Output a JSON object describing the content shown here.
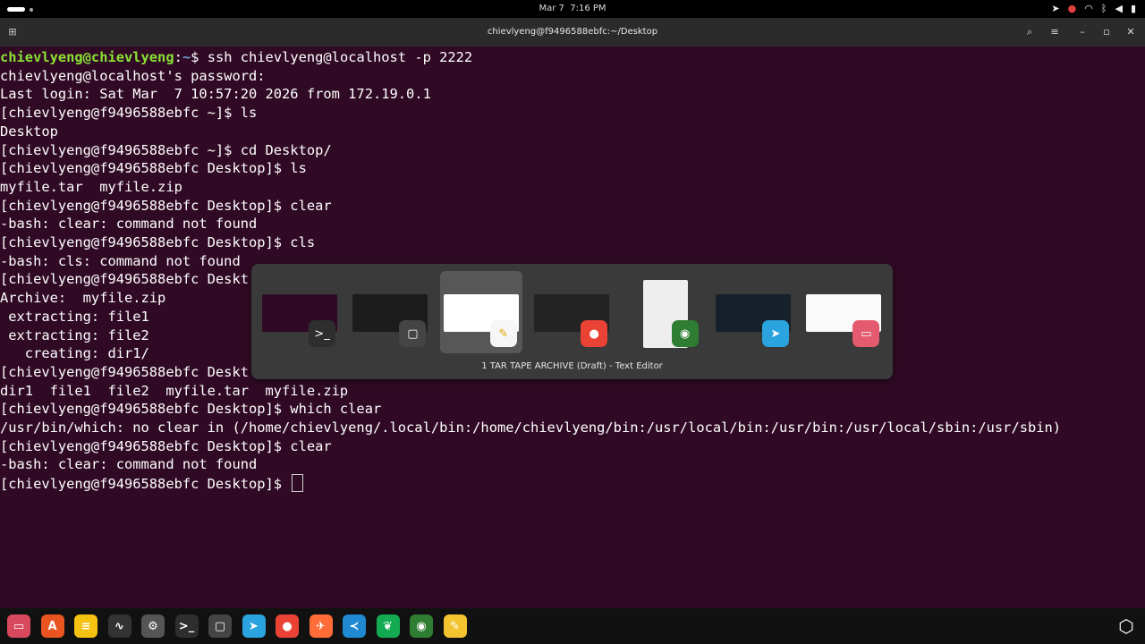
{
  "top_bar": {
    "date": "Mar 7",
    "time": "7:16 PM"
  },
  "window": {
    "title": "chievlyeng@f9496588ebfc:~/Desktop"
  },
  "terminal": {
    "lines": [
      {
        "user": "chievlyeng@chievlyeng",
        "sep": ":",
        "path": "~",
        "rest": "$ ssh chievlyeng@localhost -p 2222"
      },
      {
        "text": "chievlyeng@localhost's password:"
      },
      {
        "text": "Last login: Sat Mar  7 10:57:20 2026 from 172.19.0.1"
      },
      {
        "text": "[chievlyeng@f9496588ebfc ~]$ ls"
      },
      {
        "text": "Desktop"
      },
      {
        "text": "[chievlyeng@f9496588ebfc ~]$ cd Desktop/"
      },
      {
        "text": "[chievlyeng@f9496588ebfc Desktop]$ ls"
      },
      {
        "text": "myfile.tar  myfile.zip"
      },
      {
        "text": "[chievlyeng@f9496588ebfc Desktop]$ clear"
      },
      {
        "text": "-bash: clear: command not found"
      },
      {
        "text": "[chievlyeng@f9496588ebfc Desktop]$ cls"
      },
      {
        "text": "-bash: cls: command not found"
      },
      {
        "text": "[chievlyeng@f9496588ebfc Deskt"
      },
      {
        "text": "Archive:  myfile.zip"
      },
      {
        "text": " extracting: file1"
      },
      {
        "text": " extracting: file2"
      },
      {
        "text": "   creating: dir1/"
      },
      {
        "text": "[chievlyeng@f9496588ebfc Deskt"
      },
      {
        "text": "dir1  file1  file2  myfile.tar  myfile.zip"
      },
      {
        "text": "[chievlyeng@f9496588ebfc Desktop]$ which clear"
      },
      {
        "text": "/usr/bin/which: no clear in (/home/chievlyeng/.local/bin:/home/chievlyeng/bin:/usr/local/bin:/usr/bin:/usr/local/sbin:/usr/sbin)"
      },
      {
        "text": "[chievlyeng@f9496588ebfc Desktop]$ clear"
      },
      {
        "text": "-bash: clear: command not found"
      },
      {
        "text": "[chievlyeng@f9496588ebfc Desktop]$ ",
        "cursor": true
      }
    ]
  },
  "app_switcher": {
    "selected_label": "1 TAR TAPE ARCHIVE (Draft) - Text Editor",
    "apps": [
      {
        "icon": "terminal-icon",
        "glyph": ">_",
        "color": "#2e2e2e",
        "thumb": "#300a24"
      },
      {
        "icon": "screenshot-tool-icon",
        "glyph": "▢",
        "color": "#444444",
        "thumb": "#1c1c1c"
      },
      {
        "icon": "text-editor-icon",
        "glyph": "✎",
        "color": "#f6f6f6",
        "thumb": "#ffffff",
        "selected": true
      },
      {
        "icon": "chrome-icon",
        "glyph": "●",
        "color": "#ea4335",
        "thumb": "#232323"
      },
      {
        "icon": "camera-app-icon",
        "glyph": "◉",
        "color": "#2e7d32",
        "thumb": "#eeeeee"
      },
      {
        "icon": "telegram-icon",
        "glyph": "➤",
        "color": "#2aa3df",
        "thumb": "#17212b"
      },
      {
        "icon": "files-icon",
        "glyph": "▭",
        "color": "#e45a6e",
        "thumb": "#fafafa"
      }
    ]
  },
  "dock": {
    "apps": [
      {
        "icon": "files-icon",
        "glyph": "▭",
        "color": "#d9495e"
      },
      {
        "icon": "app-center-icon",
        "glyph": "A",
        "color": "#e95420"
      },
      {
        "icon": "notes-icon",
        "glyph": "≡",
        "color": "#f5c211"
      },
      {
        "icon": "system-monitor-icon",
        "glyph": "∿",
        "color": "#333333"
      },
      {
        "icon": "settings-icon",
        "glyph": "⚙",
        "color": "#555555"
      },
      {
        "icon": "terminal-icon",
        "glyph": ">_",
        "color": "#2e2e2e"
      },
      {
        "icon": "screenshot-tool-icon",
        "glyph": "▢",
        "color": "#444444"
      },
      {
        "icon": "telegram-icon",
        "glyph": "➤",
        "color": "#2aa3df"
      },
      {
        "icon": "chrome-icon",
        "glyph": "●",
        "color": "#ea4335"
      },
      {
        "icon": "postman-icon",
        "glyph": "✈",
        "color": "#ff6c37"
      },
      {
        "icon": "vscode-icon",
        "glyph": "≺",
        "color": "#1f8ad2"
      },
      {
        "icon": "mongodb-compass-icon",
        "glyph": "❦",
        "color": "#13aa52"
      },
      {
        "icon": "camera-app-icon",
        "glyph": "◉",
        "color": "#2e7d32"
      },
      {
        "icon": "text-editor-icon",
        "glyph": "✎",
        "color": "#f4c430"
      }
    ],
    "show_apps": {
      "icon": "show-apps-icon",
      "glyph": "⬡"
    }
  }
}
